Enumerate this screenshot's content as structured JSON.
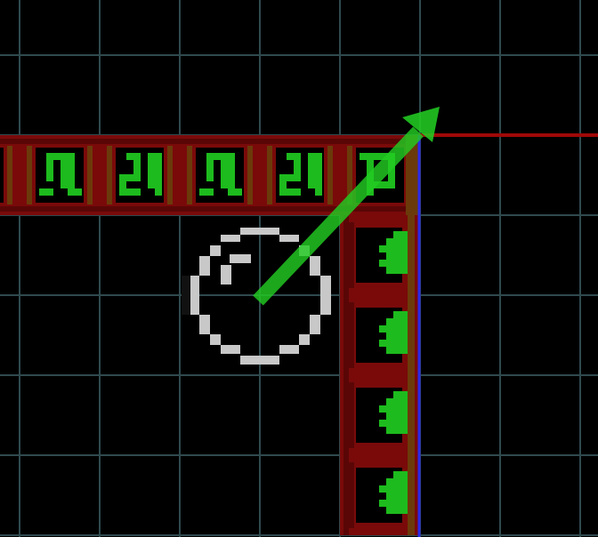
{
  "scene": {
    "background": "#000000",
    "grid_color": "#2f4a4e",
    "belt_red": "#7a0a0a",
    "belt_dark_red": "#5a0606",
    "belt_brown": "#6b3a0a",
    "chip_green": "#1dbb1d",
    "chip_dark": "#000000",
    "highlight_blue": "#2a2ae6",
    "guide_red": "#a00808",
    "arrow_green": "#22cc22",
    "cursor_gray": "#c8c8c8"
  },
  "horizontal_belt": {
    "tile_count": 6,
    "glyphs": [
      "partial",
      "bracket-a",
      "bracket-b",
      "bracket-a",
      "bracket-b",
      "corner"
    ]
  },
  "vertical_belt": {
    "tile_count": 4,
    "glyphs": [
      "comb",
      "comb",
      "comb",
      "comb"
    ]
  },
  "cursor": {
    "icon": "rotate-dial-icon"
  },
  "arrow": {
    "icon": "direction-arrow-icon",
    "direction": "up-right"
  }
}
